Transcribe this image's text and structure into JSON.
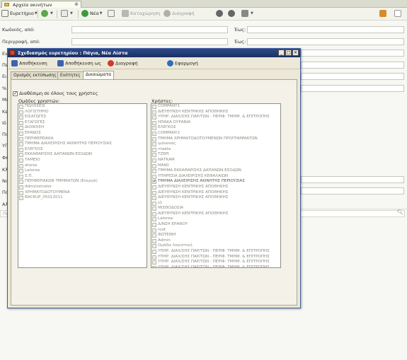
{
  "tab": {
    "title": "Αρχεία ακινήτων",
    "close": "⊗"
  },
  "toolbar": {
    "index": "Ευρετήριο",
    "new": "Νέα",
    "record": "Καταχώρηση",
    "delete": "Διαγραφή"
  },
  "form": {
    "code_from": "Κωδικός, από:",
    "code_to": "Έως:",
    "desc_from": "Περιγραφή, από:",
    "desc_to": "Έως:",
    "side_labels": [
      "Εν",
      "Πε",
      "Ει",
      "%",
      "Μι",
      "Κε",
      "Ιδ",
      "Πα",
      "ΥΠ",
      "ΦΑ",
      "Κλ",
      "Να",
      "Πό",
      "Αλ",
      "Πε"
    ],
    "search_placeholder": "Πε"
  },
  "dialog": {
    "title": "Σχεδιασμός ευρετηρίου : Πάγια, Νέα Λίστα",
    "buttons": {
      "minimize": "_",
      "maximize": "□",
      "close": "✕"
    },
    "toolbar": {
      "save": "Αποθήκευση",
      "save_as": "Αποθήκευση ως",
      "delete": "Διαγραφή",
      "apply": "Εφαρμογή"
    },
    "tabs": [
      "Ορισμός εκτύπωσης",
      "Ενότητες",
      "Δικαιώματα"
    ],
    "all_users_label": "Διαθέσιμη σε όλους τους χρήστες",
    "groups_label": "Ομάδες χρηστών:",
    "users_label": "Χρήστες:",
    "groups": [
      "ΠΩΛΗΣΕΙΣ",
      "ΛΟΓΙΣΤΗΡΙΟ",
      "ΕΙΣΑΓΩΓΕΣ",
      "ΕΞΑΓΩΓΕΣ",
      "ΔΙΟΙΚΗΣΗ",
      "ΕΡΑΝΟΣ",
      "ΠΕΡΙΦΕΡΕΙΑΚΑ",
      "ΤΜΗΜΑ ΔΙΑΧΕΙΡΙΣΗΣ ΑΚΙΝΗΤΗΣ ΠΕΡΙΟΥΣΙΑΣ",
      "ΕΛΕΓΚΟΣ",
      "ΕΚΚΑΘΑΡΙΣΗΣ ΔΑΠΑΝΩΝ-ΕΣΟΔΩΝ",
      "ΤΑΜΕΙΟ",
      "atores",
      "Latorea",
      "Σ.Π.",
      "ΠΕΡΙΦΕΡΙΑΚΩΝ ΤΜΗΜΑΤΩΝ (Ενεργά)",
      "Administrator",
      "ΧΡΗΜΑΤΟΔΟΤΟΥΜΕΝΑ",
      "BACKUP_05012011"
    ],
    "users": [
      "COMPANY1",
      "ΔΙΕΥΘΥΝΣΗ ΚΕΝΤΡΙΚΗΣ ΑΠΟΘΗΚΗΣ",
      "ΥΠΗΡ. ΔΙΑΧ/ΣΗΣ ΠΑΡ/ΤΩΝ - ΠΕΡΙΦ. ΤΜΗΜ. & ΕΠΙΤΡΟΠΗΣ",
      "ΗΠΑΚΑ ΟΥΡΑΝΙΑ",
      "ΕΛΕΓΚΟΣ",
      "COMPANY2",
      "ΤΜΗΜΑ ΧΡΗΜΑΤΟΔΟΤΟΥΜΕΝΩΝ ΠΡΟΓΡΑΜΜΑΤΩΝ",
      "ιμόνονας",
      "ntaata",
      "ΤΖΕΡΙ",
      "ΝΑΤΚΑΜ",
      "ΜΑΙΚΙ",
      "ΤΜΗΜΑ ΕΚΚΑΘΑΡΙΣΗΣ ΔΑΠΑΝΩΝ-ΕΣΟΔΩΝ",
      "ΥΠΗΡΕΣΙΑ ΔΙΑΧΕΙΡΙΣΗΣ ΚΕΦΑΛΑΙΩΝ",
      "ΤΜΗΜΑ ΔΙΑΧΕΙΡΙΣΗΣ ΑΚΙΝΗΤΗΣ ΠΕΡΙΟΥΣΙΑΣ",
      "ΔΙΕΥΘΥΝΣΗ ΚΕΝΤΡΙΚΗΣ ΑΠΟΘΗΚΗΣ",
      "ΔΙΕΥΘΥΝΣΗ ΚΕΝΤΡΙΚΗΣ ΑΠΟΘΗΚΗΣ",
      "ΔΙΕΥΘΥΝΣΗ ΚΕΝΤΡΙΚΗΣ ΑΠΟΘΗΚΗΣ",
      "s1",
      "ΜΙΣΘΟΔΟΣΙΑ",
      "ΔΙΕΥΘΥΝΣΗ ΚΕΝΤΡΙΚΗΣ ΑΠΟΘΗΚΗΣ",
      "Latorea",
      "Δ/ΝΣΗ ΕΡΑΝΟΥ",
      "root",
      "ΦΩΤΕΙΝΗ",
      "Admin",
      "Ομάδα Λογιστική",
      "ΥΠΗΡ. ΔΙΑΧ/ΣΗΣ ΠΑΡ/ΤΩΝ - ΠΕΡΙΦ. ΤΜΗΜ. & ΕΠΙΤΡΟΠΗΣ",
      "ΥΠΗΡ. ΔΙΑΧ/ΣΗΣ ΠΑΡ/ΤΩΝ - ΠΕΡΙΦ. ΤΜΗΜ. & ΕΠΙΤΡΟΠΗΣ",
      "ΥΠΗΡ. ΔΙΑΧ/ΣΗΣ ΠΑΡ/ΤΩΝ - ΠΕΡΙΦ. ΤΜΗΜ. & ΕΠΙΤΡΟΠΗΣ",
      "ΥΠΗΡ. ΔΙΑΧ/ΣΗΣ ΠΑΡ/ΤΩΝ - ΠΕΡΙΦ. ΤΜΗΜ. & ΕΠΙΤΡΟΠΗΣ"
    ],
    "users_checked_index": 14
  }
}
